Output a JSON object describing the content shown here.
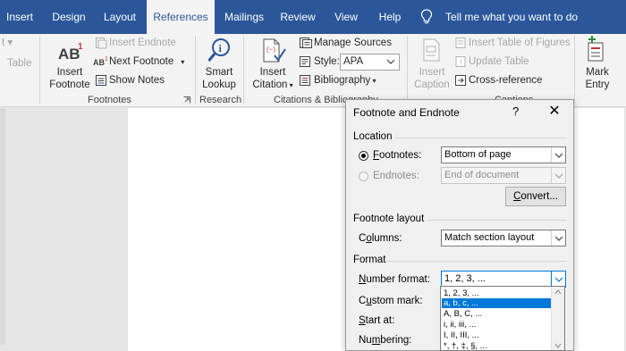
{
  "tabs": [
    {
      "label": "Insert",
      "active": false
    },
    {
      "label": "Design",
      "active": false
    },
    {
      "label": "Layout",
      "active": false
    },
    {
      "label": "References",
      "active": true
    },
    {
      "label": "Mailings",
      "active": false
    },
    {
      "label": "Review",
      "active": false
    },
    {
      "label": "View",
      "active": false
    },
    {
      "label": "Help",
      "active": false
    }
  ],
  "tell_me": "Tell me what you want to do",
  "ribbon": {
    "toc_partial": "Table",
    "footnotes": {
      "insert_footnote_line1": "Insert",
      "insert_footnote_line2": "Footnote",
      "insert_endnote": "Insert Endnote",
      "next_footnote": "Next Footnote",
      "show_notes": "Show Notes",
      "group_label": "Footnotes"
    },
    "research": {
      "smart_lookup_line1": "Smart",
      "smart_lookup_line2": "Lookup",
      "group_label": "Research"
    },
    "citations": {
      "insert_citation_line1": "Insert",
      "insert_citation_line2": "Citation",
      "manage_sources": "Manage Sources",
      "style_label": "Style:",
      "style_value": "APA",
      "bibliography": "Bibliography",
      "group_label": "Citations & Bibliography"
    },
    "captions": {
      "insert_caption_line1": "Insert",
      "insert_caption_line2": "Caption",
      "insert_table_of_figures": "Insert Table of Figures",
      "update_table": "Update Table",
      "cross_reference": "Cross-reference",
      "group_label": "Captions"
    },
    "index": {
      "mark_entry_line1": "Mark",
      "mark_entry_line2": "Entry"
    }
  },
  "dialog": {
    "title": "Footnote and Endnote",
    "help": "?",
    "close": "✕",
    "location": {
      "section": "Location",
      "footnotes_label": "Footnotes:",
      "footnotes_accel": "F",
      "footnotes_rest": "ootnotes:",
      "footnotes_value": "Bottom of page",
      "footnotes_selected": true,
      "endnotes_label": "Endnotes:",
      "endnotes_value": "End of document",
      "convert_button_accel": "C",
      "convert_button_rest": "onvert..."
    },
    "layout": {
      "section": "Footnote layout",
      "columns_accel": "o",
      "columns_pre": "C",
      "columns_rest": "lumns:",
      "columns_value": "Match section layout"
    },
    "format": {
      "section": "Format",
      "number_format_accel": "N",
      "number_format_rest": "umber format:",
      "number_format_value": "1, 2, 3, ...",
      "custom_mark_accel": "u",
      "custom_mark_pre": "C",
      "custom_mark_rest": "stom mark:",
      "start_at_accel": "S",
      "start_at_rest": "tart at:",
      "numbering_accel": "m",
      "numbering_pre": "Nu",
      "numbering_rest": "bering:"
    },
    "number_format_options": [
      {
        "label": "1, 2, 3, ...",
        "selected": false
      },
      {
        "label": "a, b, c, ...",
        "selected": true
      },
      {
        "label": "A, B, C, ...",
        "selected": false
      },
      {
        "label": "i, ii, iii, ...",
        "selected": false
      },
      {
        "label": "I, II, III, ...",
        "selected": false
      },
      {
        "label": "*, †, ‡, §, ...",
        "selected": false
      }
    ]
  },
  "colors": {
    "ribbon_blue": "#2b579a",
    "selection_blue": "#0078d7"
  }
}
